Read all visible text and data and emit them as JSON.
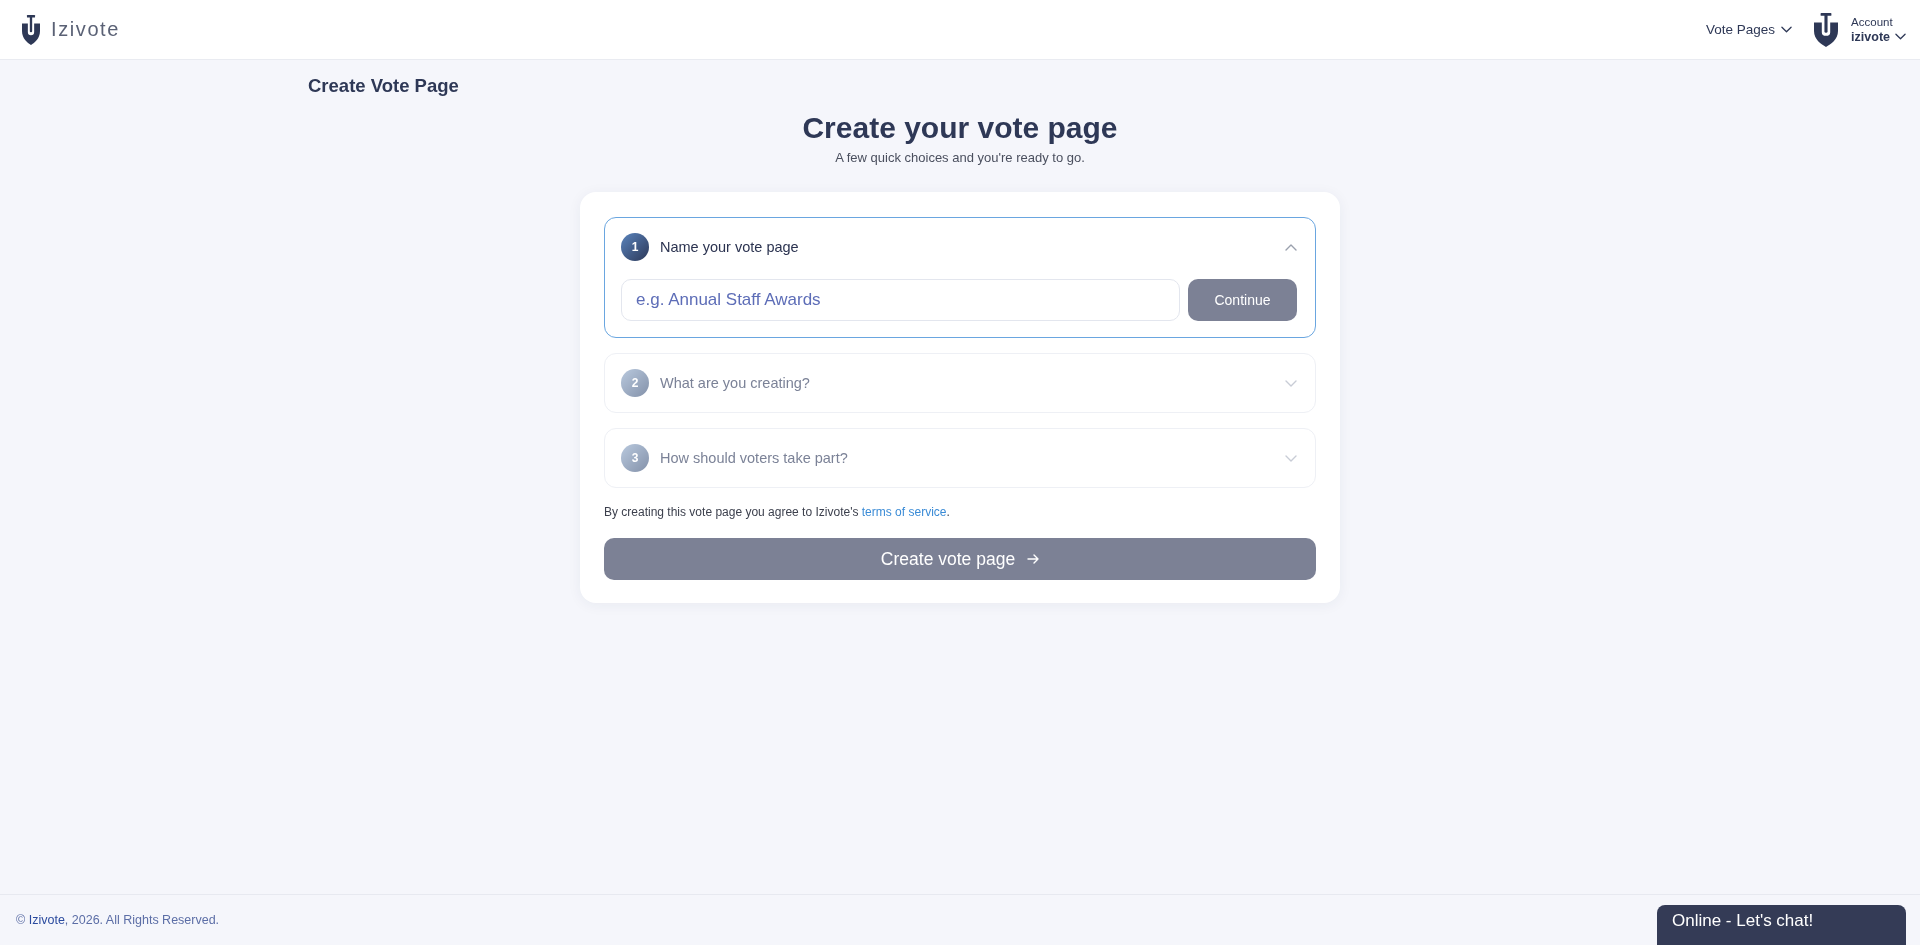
{
  "header": {
    "brand": "Izivote",
    "nav": [
      {
        "label": "Vote Pages"
      }
    ],
    "account": {
      "caption": "Account",
      "name": "izivote"
    }
  },
  "page_title": "Create Vote Page",
  "hero": {
    "title": "Create your vote page",
    "subtitle": "A few quick choices and you're ready to go."
  },
  "steps": [
    {
      "number": "1",
      "title": "Name your vote page",
      "expanded": true,
      "input": {
        "placeholder": "e.g. Annual Staff Awards"
      },
      "button": "Continue"
    },
    {
      "number": "2",
      "title": "What are you creating?",
      "expanded": false
    },
    {
      "number": "3",
      "title": "How should voters take part?",
      "expanded": false
    }
  ],
  "terms": {
    "before": "By creating this vote page you agree to Izivote's",
    "link": "terms of service",
    "after": "."
  },
  "submit": {
    "label": "Create vote page"
  },
  "footer": {
    "before": "©",
    "link": "Izivote",
    "after": ", 2026. All Rights Reserved."
  },
  "chat": {
    "label": "Online - Let's chat!"
  }
}
